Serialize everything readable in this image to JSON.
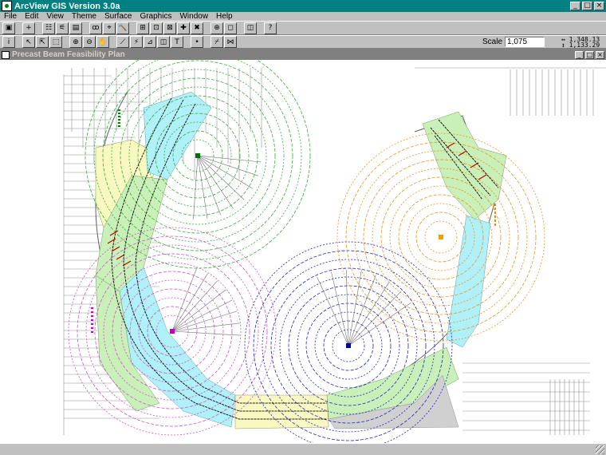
{
  "app": {
    "title": "ArcView GIS Version 3.0a"
  },
  "window_controls": {
    "minimize": "_",
    "maximize": "□",
    "close": "×"
  },
  "menu": [
    "File",
    "Edit",
    "View",
    "Theme",
    "Surface",
    "Graphics",
    "Window",
    "Help"
  ],
  "toolbar1": [
    {
      "name": "save-project-button",
      "icon": "save-icon",
      "glyph": "▣"
    },
    {
      "name": "add-theme-button",
      "icon": "add-icon",
      "glyph": "+"
    },
    {
      "name": "theme-properties-button",
      "icon": "properties-icon",
      "glyph": "☷"
    },
    {
      "name": "edit-legend-button",
      "icon": "legend-icon",
      "glyph": "⚟"
    },
    {
      "name": "open-table-button",
      "icon": "table-icon",
      "glyph": "▤"
    },
    {
      "name": "find-button",
      "icon": "binoculars-icon",
      "glyph": "ꝏ"
    },
    {
      "name": "locate-button",
      "icon": "locate-icon",
      "glyph": "⌖"
    },
    {
      "name": "query-button",
      "icon": "query-icon",
      "glyph": "🔨"
    },
    {
      "name": "zoom-full-button",
      "icon": "zoom-full-icon",
      "glyph": "⊞"
    },
    {
      "name": "zoom-active-button",
      "icon": "zoom-active-icon",
      "glyph": "⊡"
    },
    {
      "name": "zoom-selected-button",
      "icon": "zoom-selected-icon",
      "glyph": "⊠"
    },
    {
      "name": "zoom-in-button",
      "icon": "zoom-in-icon",
      "glyph": "✚"
    },
    {
      "name": "zoom-out-button",
      "icon": "zoom-out-icon",
      "glyph": "✖"
    },
    {
      "name": "select-features-button",
      "icon": "select-icon",
      "glyph": "⊕"
    },
    {
      "name": "clear-selection-button",
      "icon": "clear-icon",
      "glyph": "◻"
    },
    {
      "name": "previous-extent-button",
      "icon": "back-icon",
      "glyph": "◫"
    },
    {
      "name": "help-button",
      "icon": "help-cursor-icon",
      "glyph": "?"
    }
  ],
  "toolbar2": [
    {
      "name": "identify-tool",
      "icon": "identify-icon",
      "glyph": "i"
    },
    {
      "name": "pointer-tool",
      "icon": "pointer-icon",
      "glyph": "↖"
    },
    {
      "name": "vertex-edit-tool",
      "icon": "vertex-icon",
      "glyph": "⇱"
    },
    {
      "name": "select-feature-tool",
      "icon": "select-arrow-icon",
      "glyph": "⬚"
    },
    {
      "name": "zoom-in-tool",
      "icon": "magnify-plus-icon",
      "glyph": "⊕"
    },
    {
      "name": "zoom-out-tool",
      "icon": "magnify-minus-icon",
      "glyph": "⊖"
    },
    {
      "name": "pan-tool",
      "icon": "hand-icon",
      "glyph": "✋"
    },
    {
      "name": "measure-tool",
      "icon": "measure-icon",
      "glyph": "⟋"
    },
    {
      "name": "hotlink-tool",
      "icon": "hotlink-icon",
      "glyph": "⚡"
    },
    {
      "name": "area-of-interest-tool",
      "icon": "area-icon",
      "glyph": "⊿"
    },
    {
      "name": "label-tool",
      "icon": "label-icon",
      "glyph": "◫"
    },
    {
      "name": "text-tool",
      "icon": "text-icon",
      "glyph": "T"
    },
    {
      "name": "draw-point-tool",
      "icon": "point-icon",
      "glyph": "•"
    },
    {
      "name": "draw-line-tool",
      "icon": "line-icon",
      "glyph": "⌿"
    },
    {
      "name": "snap-tool",
      "icon": "snap-icon",
      "glyph": "⋈"
    }
  ],
  "scale": {
    "label": "Scale 1:",
    "value": "1,075"
  },
  "coordinates": {
    "x": "↔ 1,348.13",
    "y": "↕ 1,133.29"
  },
  "view": {
    "title": "Precast Beam Feasibility Plan"
  },
  "map": {
    "colors": {
      "ramp_cyan": "#b0f0f8",
      "ramp_green": "#c8f0b8",
      "ramp_yellow": "#f8f8c0",
      "ramp_gray": "#d0d0d0",
      "crane_green": "#008000",
      "crane_magenta": "#c000c0",
      "crane_blue": "#0000c0",
      "crane_orange": "#f0a000"
    },
    "cranes": [
      {
        "name": "crane-green",
        "color": "#30b030",
        "marker": "#007000"
      },
      {
        "name": "crane-magenta",
        "color": "#d050d0",
        "marker": "#c000c0"
      },
      {
        "name": "crane-blue",
        "color": "#2020c0",
        "marker": "#0000b0"
      },
      {
        "name": "crane-orange",
        "color": "#f09020",
        "marker": "#f0a000"
      }
    ]
  },
  "status": {
    "text": ""
  }
}
